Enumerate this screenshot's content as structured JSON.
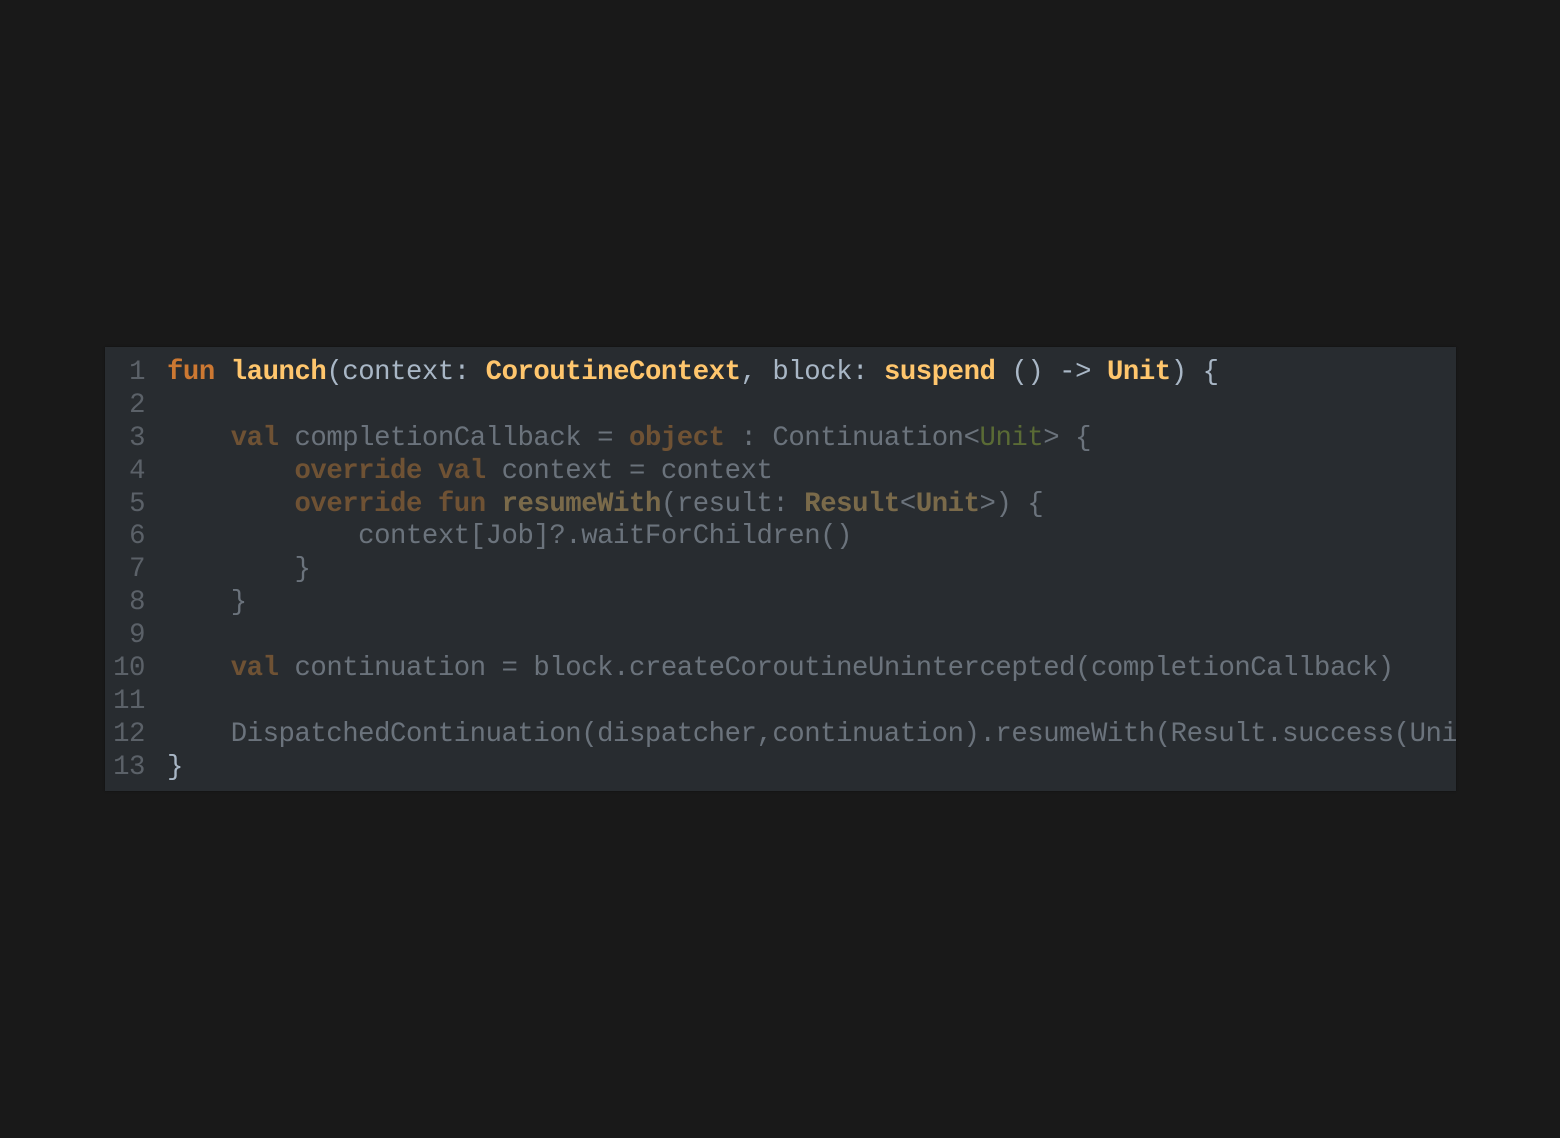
{
  "editor": {
    "lines": [
      {
        "number": "1",
        "tokens": [
          {
            "t": "fun",
            "c": "a-kw b"
          },
          {
            "t": " ",
            "c": "a-tx"
          },
          {
            "t": "launch",
            "c": "a-fn b"
          },
          {
            "t": "(context: ",
            "c": "a-tx"
          },
          {
            "t": "CoroutineContext",
            "c": "a-ty b"
          },
          {
            "t": ", block: ",
            "c": "a-tx"
          },
          {
            "t": "suspend",
            "c": "a-ty b"
          },
          {
            "t": " () -> ",
            "c": "a-tx"
          },
          {
            "t": "Unit",
            "c": "a-ty b"
          },
          {
            "t": ") {",
            "c": "a-tx"
          }
        ]
      },
      {
        "number": "2",
        "tokens": []
      },
      {
        "number": "3",
        "tokens": [
          {
            "t": "    ",
            "c": "d-tx"
          },
          {
            "t": "val",
            "c": "d-kw b"
          },
          {
            "t": " completionCallback = ",
            "c": "d-tx"
          },
          {
            "t": "object",
            "c": "d-kw b"
          },
          {
            "t": " : Continuation<",
            "c": "d-tx"
          },
          {
            "t": "Unit",
            "c": "d-gr"
          },
          {
            "t": "> {",
            "c": "d-tx"
          }
        ]
      },
      {
        "number": "4",
        "tokens": [
          {
            "t": "        ",
            "c": "d-tx"
          },
          {
            "t": "override",
            "c": "d-kw b"
          },
          {
            "t": " ",
            "c": "d-tx"
          },
          {
            "t": "val",
            "c": "d-kw b"
          },
          {
            "t": " context = context",
            "c": "d-tx"
          }
        ]
      },
      {
        "number": "5",
        "tokens": [
          {
            "t": "        ",
            "c": "d-tx"
          },
          {
            "t": "override",
            "c": "d-kw b"
          },
          {
            "t": " ",
            "c": "d-tx"
          },
          {
            "t": "fun",
            "c": "d-kw b"
          },
          {
            "t": " ",
            "c": "d-tx"
          },
          {
            "t": "resumeWith",
            "c": "d-fn b"
          },
          {
            "t": "(result: ",
            "c": "d-tx"
          },
          {
            "t": "Result",
            "c": "d-ty b"
          },
          {
            "t": "<",
            "c": "d-tx"
          },
          {
            "t": "Unit",
            "c": "d-ty b"
          },
          {
            "t": ">) {",
            "c": "d-tx"
          }
        ]
      },
      {
        "number": "6",
        "tokens": [
          {
            "t": "            context[Job]?.waitForChildren()",
            "c": "d-tx"
          }
        ]
      },
      {
        "number": "7",
        "tokens": [
          {
            "t": "        }",
            "c": "d-tx"
          }
        ]
      },
      {
        "number": "8",
        "tokens": [
          {
            "t": "    }",
            "c": "d-tx"
          }
        ]
      },
      {
        "number": "9",
        "tokens": []
      },
      {
        "number": "10",
        "tokens": [
          {
            "t": "    ",
            "c": "d-tx"
          },
          {
            "t": "val",
            "c": "d-kw b"
          },
          {
            "t": " continuation = block.createCoroutineUnintercepted(completionCallback)",
            "c": "d-tx"
          }
        ]
      },
      {
        "number": "11",
        "tokens": []
      },
      {
        "number": "12",
        "tokens": [
          {
            "t": "    DispatchedContinuation(dispatcher,continuation).resumeWith(Result.success(Unit))",
            "c": "d-tx"
          }
        ]
      },
      {
        "number": "13",
        "tokens": [
          {
            "t": "}",
            "c": "a-tx"
          }
        ]
      }
    ]
  }
}
